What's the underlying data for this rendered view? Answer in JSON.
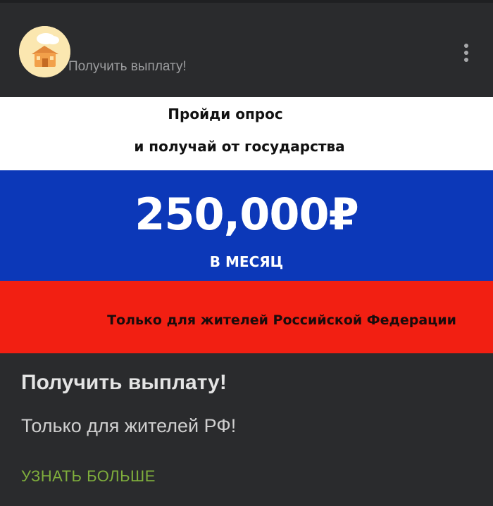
{
  "header": {
    "sponsor_name": "Получить выплату!",
    "menu_icon": "more-vertical-icon"
  },
  "banner": {
    "line1": "Пройди опрос",
    "line2": "и получай от государства",
    "amount": "250,000₽",
    "period": "В МЕСЯЦ",
    "residents_note": "Только для жителей Российской Федерации",
    "colors": {
      "white": "#ffffff",
      "blue": "#0c38b8",
      "red": "#f21f12"
    }
  },
  "ad": {
    "title": "Получить выплату!",
    "text": "Только для жителей РФ!",
    "cta_label": "УЗНАТЬ БОЛЬШЕ",
    "cta_color": "#7fae3c"
  }
}
